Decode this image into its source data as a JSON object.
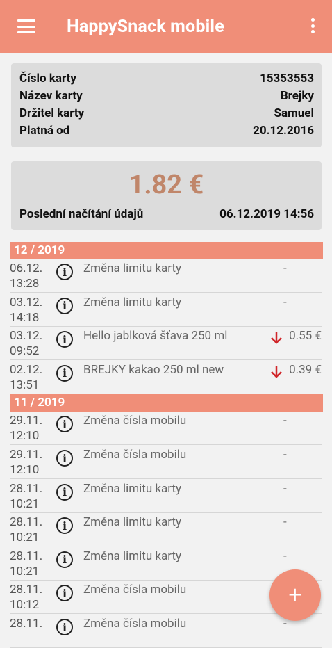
{
  "app": {
    "title": "HappySnack mobile",
    "accent_color": "#f08e78",
    "menu_icon": "menu-icon",
    "more_icon": "more-vert-icon"
  },
  "card": {
    "number_label": "Číslo karty",
    "number_value": "15353553",
    "name_label": "Název karty",
    "name_value": "Brejky",
    "holder_label": "Držitel karty",
    "holder_value": "Samuel",
    "valid_label": "Platná od",
    "valid_value": "20.12.2016"
  },
  "balance": {
    "amount": "1.82 €",
    "last_load_label": "Poslední načítání údajů",
    "last_load_value": "06.12.2019 14:56"
  },
  "months": [
    {
      "label": "12 / 2019",
      "transactions": [
        {
          "date": "06.12.",
          "time": "13:28",
          "desc": "Změna limitu karty",
          "amount": "-"
        },
        {
          "date": "03.12.",
          "time": "14:18",
          "desc": "Změna limitu karty",
          "amount": "-"
        },
        {
          "date": "03.12.",
          "time": "09:52",
          "desc": "Hello jablková šťava 250 ml",
          "amount": "0.55 €",
          "direction": "down"
        },
        {
          "date": "02.12.",
          "time": "13:51",
          "desc": "BREJKY kakao 250 ml new",
          "amount": "0.39 €",
          "direction": "down"
        }
      ]
    },
    {
      "label": "11 / 2019",
      "transactions": [
        {
          "date": "29.11.",
          "time": "12:10",
          "desc": "Změna čísla mobilu",
          "amount": "-"
        },
        {
          "date": "29.11.",
          "time": "12:10",
          "desc": "Změna čísla mobilu",
          "amount": "-"
        },
        {
          "date": "28.11.",
          "time": "10:21",
          "desc": "Změna limitu karty",
          "amount": "-"
        },
        {
          "date": "28.11.",
          "time": "10:21",
          "desc": "Změna limitu karty",
          "amount": "-"
        },
        {
          "date": "28.11.",
          "time": "10:21",
          "desc": "Změna limitu karty",
          "amount": "-"
        },
        {
          "date": "28.11.",
          "time": "10:12",
          "desc": "Změna čísla mobilu",
          "amount": "-"
        },
        {
          "date": "28.11.",
          "time": "",
          "desc": "Změna čísla mobilu",
          "amount": "-"
        }
      ]
    }
  ],
  "fab": {
    "label": "+",
    "icon": "add-icon"
  }
}
